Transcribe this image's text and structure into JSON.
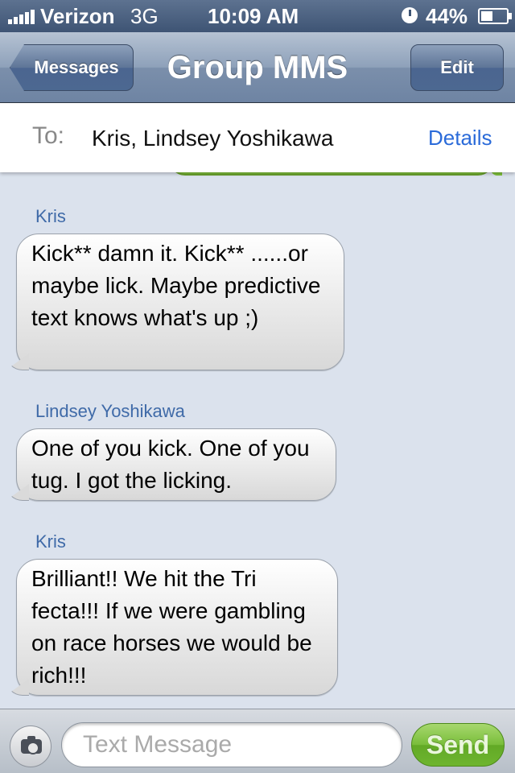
{
  "status_bar": {
    "carrier": "Verizon",
    "network": "3G",
    "time": "10:09 AM",
    "battery_percent": "44%"
  },
  "nav": {
    "back_label": "Messages",
    "title": "Group MMS",
    "edit_label": "Edit"
  },
  "to_bar": {
    "label": "To:",
    "recipients": "Kris, Lindsey Yoshikawa",
    "details_label": "Details"
  },
  "messages": [
    {
      "sender": "Kris",
      "text": "Kick** damn it.  Kick** ......or maybe lick. Maybe predictive text knows what's up ;)"
    },
    {
      "sender": "Lindsey Yoshikawa",
      "text": "One of you kick. One of you tug. I got the licking."
    },
    {
      "sender": "Kris",
      "text": "Brilliant!! We hit the Tri fecta!!! If we were gambling on race horses we would be rich!!!"
    }
  ],
  "composer": {
    "placeholder": "Text Message",
    "send_label": "Send"
  },
  "icons": {
    "camera": "camera-icon",
    "clock": "clock-icon",
    "battery": "battery-icon",
    "signal": "signal-bars-icon"
  },
  "colors": {
    "nav_bar": "#7b8fab",
    "background": "#dbe2ed",
    "sender_name": "#3f6aa8",
    "details_link": "#2b6bd9",
    "send_button": "#6eb52f",
    "outgoing_bubble": "#7fc13a"
  }
}
